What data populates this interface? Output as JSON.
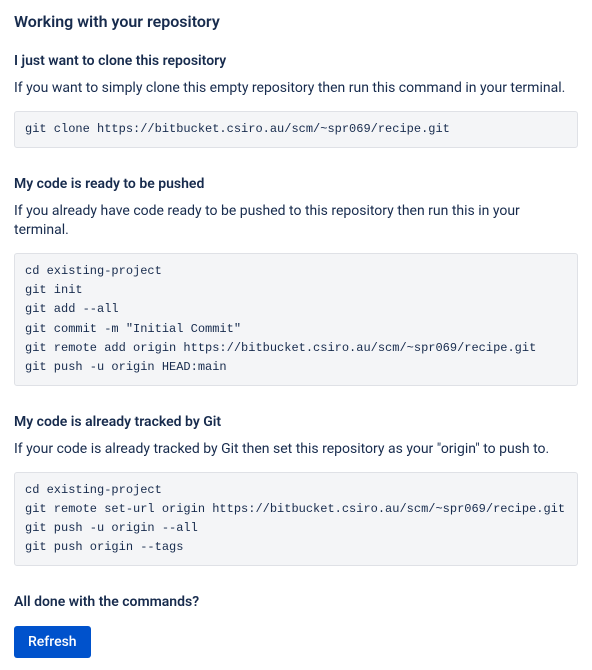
{
  "page_title": "Working with your repository",
  "sections": [
    {
      "title": "I just want to clone this repository",
      "desc": "If you want to simply clone this empty repository then run this command in your terminal.",
      "code": "git clone https://bitbucket.csiro.au/scm/~spr069/recipe.git"
    },
    {
      "title": "My code is ready to be pushed",
      "desc": "If you already have code ready to be pushed to this repository then run this in your terminal.",
      "code": "cd existing-project\ngit init\ngit add --all\ngit commit -m \"Initial Commit\"\ngit remote add origin https://bitbucket.csiro.au/scm/~spr069/recipe.git\ngit push -u origin HEAD:main"
    },
    {
      "title": "My code is already tracked by Git",
      "desc": "If your code is already tracked by Git then set this repository as your \"origin\" to push to.",
      "code": "cd existing-project\ngit remote set-url origin https://bitbucket.csiro.au/scm/~spr069/recipe.git\ngit push -u origin --all\ngit push origin --tags"
    }
  ],
  "done_title": "All done with the commands?",
  "refresh_label": "Refresh"
}
